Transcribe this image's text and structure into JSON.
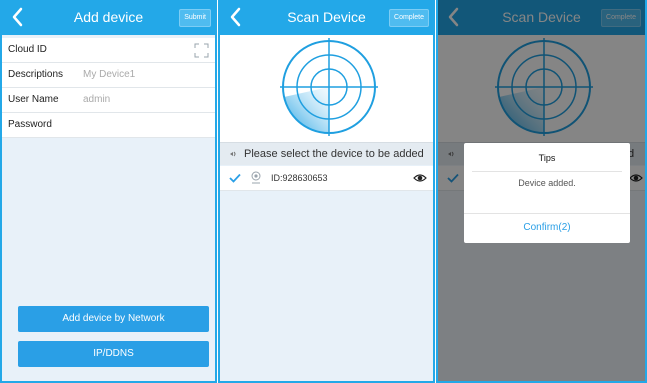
{
  "colors": {
    "accent": "#23a8e8",
    "button": "#2a9fe6",
    "overlay": "rgba(0,0,0,0.48)"
  },
  "add_device": {
    "title": "Add device",
    "submit_label": "Submit",
    "fields": [
      {
        "label": "Cloud ID",
        "value": "",
        "icon": "qr-scan-icon"
      },
      {
        "label": "Descriptions",
        "value": "My Device1"
      },
      {
        "label": "User Name",
        "value": "admin"
      },
      {
        "label": "Password",
        "value": ""
      }
    ],
    "network_button": "Add device by Network",
    "ipddns_button": "IP/DDNS"
  },
  "scan_device": {
    "title": "Scan Device",
    "complete_label": "Complete",
    "hint": "Please select the device to be added",
    "device": {
      "id": "ID:928630653",
      "checked": true
    }
  },
  "scan_device_dialog": {
    "title": "Scan Device",
    "complete_label": "Complete",
    "hint_partial_left": "",
    "hint_partial_right": "d",
    "dialog": {
      "title": "Tips",
      "message": "Device added.",
      "confirm_label": "Confirm(2)"
    }
  }
}
